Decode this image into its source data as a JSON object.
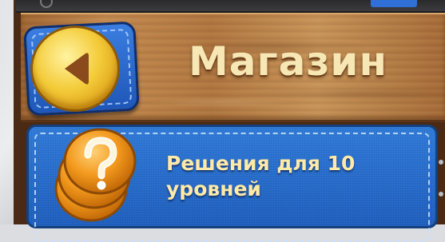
{
  "header": {
    "title": "Магазин",
    "back_button_icon": "back-arrow-icon"
  },
  "store_item": {
    "icon": "hint-question-coins-icon",
    "label_line1": "Решения для 10",
    "label_line2": "уровней"
  },
  "colors": {
    "wood": "#b07640",
    "title_text": "#f6e7b4",
    "panel_blue": "#2f7ad8",
    "coin_gold": "#f4cc3a",
    "arrow_brown": "#8a4a1c",
    "item_text": "#fde9a8"
  }
}
